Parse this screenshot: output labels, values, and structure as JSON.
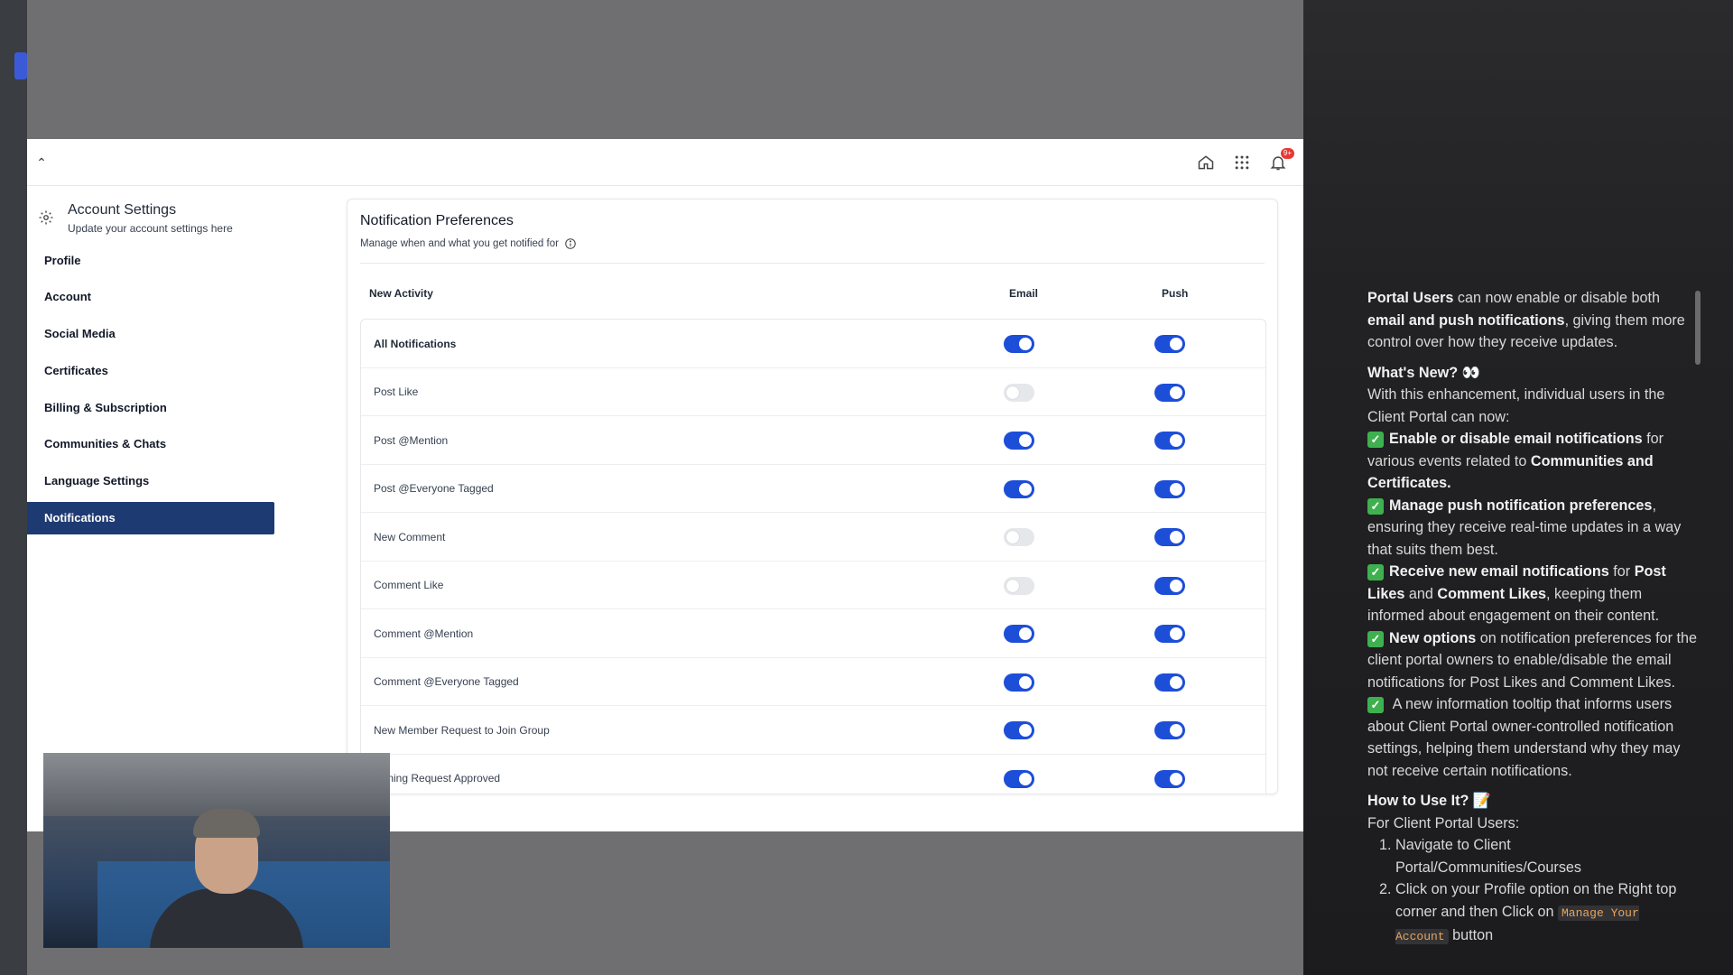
{
  "topbar": {
    "collapse_glyph": "⌃",
    "icons": [
      "home-icon",
      "apps-grid-icon",
      "bell-icon"
    ],
    "notification_badge": "9+"
  },
  "sidebar": {
    "title": "Account Settings",
    "subtitle": "Update your account settings here",
    "items": [
      {
        "label": "Profile",
        "active": false
      },
      {
        "label": "Account",
        "active": false
      },
      {
        "label": "Social Media",
        "active": false
      },
      {
        "label": "Certificates",
        "active": false
      },
      {
        "label": "Billing & Subscription",
        "active": false
      },
      {
        "label": "Communities & Chats",
        "active": false
      },
      {
        "label": "Language Settings",
        "active": false
      },
      {
        "label": "Notifications",
        "active": true
      }
    ]
  },
  "preferences": {
    "title": "Notification Preferences",
    "subtitle": "Manage when and what you get notified for",
    "columns": {
      "activity": "New Activity",
      "email": "Email",
      "push": "Push"
    },
    "rows": [
      {
        "label": "All Notifications",
        "email": true,
        "push": true
      },
      {
        "label": "Post Like",
        "email": false,
        "push": true
      },
      {
        "label": "Post @Mention",
        "email": true,
        "push": true
      },
      {
        "label": "Post @Everyone Tagged",
        "email": true,
        "push": true
      },
      {
        "label": "New Comment",
        "email": false,
        "push": true
      },
      {
        "label": "Comment Like",
        "email": false,
        "push": true
      },
      {
        "label": "Comment @Mention",
        "email": true,
        "push": true
      },
      {
        "label": "Comment @Everyone Tagged",
        "email": true,
        "push": true
      },
      {
        "label": "New Member Request to Join Group",
        "email": true,
        "push": true
      },
      {
        "label": "Joining Request Approved",
        "email": true,
        "push": true
      }
    ]
  },
  "colors": {
    "active_nav": "#1e3a72",
    "toggle_on": "#1d4ed8",
    "toggle_off": "#e5e7eb",
    "check_green": "#3fb04f"
  },
  "release_notes": {
    "intro_bold_1": "Portal Users",
    "intro_1": " can now enable or disable both ",
    "intro_bold_2": "email and push notifications",
    "intro_2": ", giving them more control over how they receive updates.",
    "whats_new_heading": "What's New? 👀",
    "whats_new_intro": "With this enhancement, individual users in the Client Portal can now:",
    "b1_bold": "Enable or disable email notifications",
    "b1_mid": " for various events related to ",
    "b1_bold2": "Communities and Certificates.",
    "b2_bold": "Manage push notification preferences",
    "b2_rest": ", ensuring they receive real-time updates in a way that suits them best.",
    "b3_bold": "Receive new email notifications",
    "b3_mid": " for ",
    "b3_bold2": "Post Likes",
    "b3_and": " and ",
    "b3_bold3": "Comment Likes",
    "b3_rest": ", keeping them informed about engagement on their content.",
    "b4_bold": "New options",
    "b4_rest": " on notification preferences for the client portal owners to enable/disable the email notifications for Post Likes and Comment Likes.",
    "b5": " A new information tooltip that informs users about Client Portal owner-controlled notification settings, helping them understand why they may not receive certain notifications.",
    "how_heading": "How to Use It? 📝",
    "for_users": "For Client Portal Users:",
    "step1": "Navigate to Client Portal/Communities/Courses",
    "step2_a": "Click on your Profile option on the Right top corner and then Click on ",
    "step2_code": "Manage Your Account",
    "step2_b": " button"
  }
}
